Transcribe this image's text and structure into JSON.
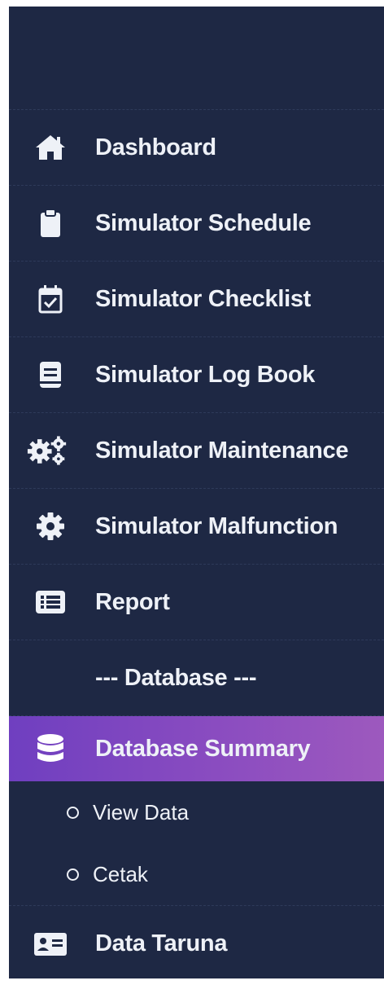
{
  "sidebar": {
    "items": [
      {
        "label": "Dashboard",
        "icon": "home-icon"
      },
      {
        "label": "Simulator Schedule",
        "icon": "clipboard-icon"
      },
      {
        "label": "Simulator Checklist",
        "icon": "calendar-check-icon"
      },
      {
        "label": "Simulator Log Book",
        "icon": "book-icon"
      },
      {
        "label": "Simulator Maintenance",
        "icon": "gears-icon"
      },
      {
        "label": "Simulator Malfunction",
        "icon": "gear-icon"
      },
      {
        "label": "Report",
        "icon": "list-alt-icon"
      }
    ],
    "section_label": "--- Database ---",
    "active_item": {
      "label": "Database Summary",
      "icon": "database-icon"
    },
    "sub_items": [
      {
        "label": "View Data"
      },
      {
        "label": "Cetak"
      }
    ],
    "last_item": {
      "label": "Data Taruna",
      "icon": "id-card-icon"
    }
  },
  "colors": {
    "background": "#1e2844",
    "text": "#eef1f7",
    "active_gradient_start": "#6f3fc0",
    "active_gradient_end": "#9d59be"
  }
}
